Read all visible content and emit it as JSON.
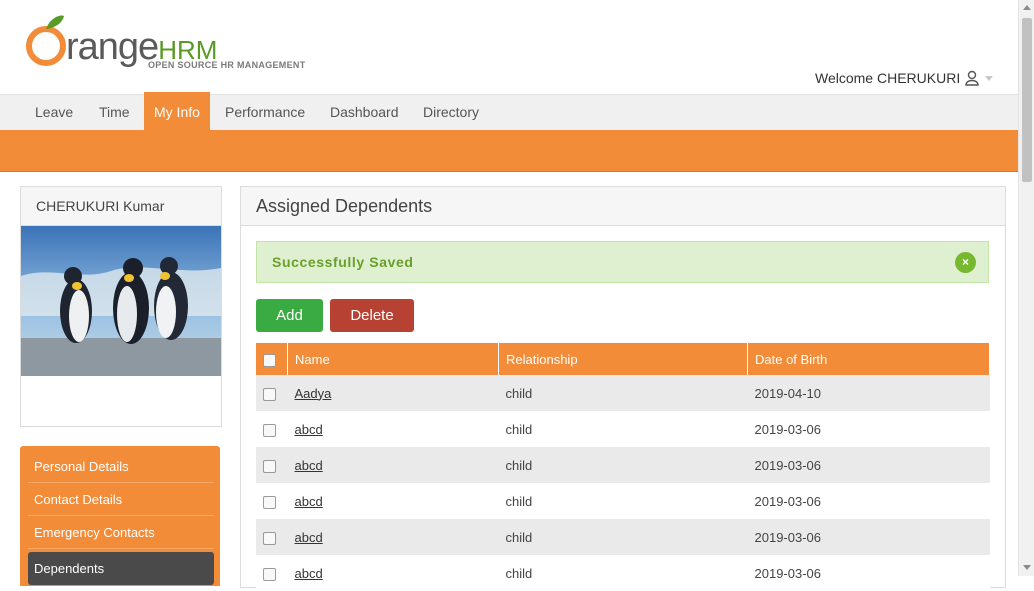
{
  "logo": {
    "main": "range",
    "hrm": "HRM",
    "tagline": "OPEN SOURCE HR MANAGEMENT"
  },
  "header": {
    "welcome": "Welcome CHERUKURI"
  },
  "nav": {
    "items": [
      "Leave",
      "Time",
      "My Info",
      "Performance",
      "Dashboard",
      "Directory"
    ],
    "active": "My Info"
  },
  "profile": {
    "name": "CHERUKURI Kumar"
  },
  "sidebar": {
    "items": [
      "Personal Details",
      "Contact Details",
      "Emergency Contacts",
      "Dependents"
    ],
    "active": "Dependents"
  },
  "panel": {
    "title": "Assigned Dependents",
    "message": "Successfully Saved",
    "close_label": "×",
    "add_label": "Add",
    "delete_label": "Delete"
  },
  "table": {
    "columns": [
      "Name",
      "Relationship",
      "Date of Birth"
    ],
    "rows": [
      {
        "name": "Aadya",
        "relationship": "child",
        "dob": "2019-04-10"
      },
      {
        "name": "abcd",
        "relationship": "child",
        "dob": "2019-03-06"
      },
      {
        "name": "abcd",
        "relationship": "child",
        "dob": "2019-03-06"
      },
      {
        "name": "abcd",
        "relationship": "child",
        "dob": "2019-03-06"
      },
      {
        "name": "abcd",
        "relationship": "child",
        "dob": "2019-03-06"
      },
      {
        "name": "abcd",
        "relationship": "child",
        "dob": "2019-03-06"
      }
    ]
  },
  "colors": {
    "brand_orange": "#f28c38",
    "add_green": "#3aaa43",
    "delete_red": "#b74132",
    "success_bg": "#dff0d0"
  }
}
